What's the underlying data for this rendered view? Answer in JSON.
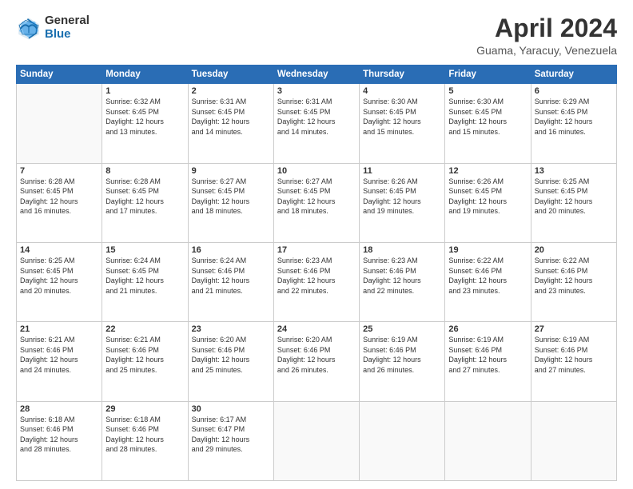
{
  "header": {
    "logo_general": "General",
    "logo_blue": "Blue",
    "month_title": "April 2024",
    "location": "Guama, Yaracuy, Venezuela"
  },
  "days_of_week": [
    "Sunday",
    "Monday",
    "Tuesday",
    "Wednesday",
    "Thursday",
    "Friday",
    "Saturday"
  ],
  "weeks": [
    [
      {
        "day": "",
        "info": ""
      },
      {
        "day": "1",
        "info": "Sunrise: 6:32 AM\nSunset: 6:45 PM\nDaylight: 12 hours\nand 13 minutes."
      },
      {
        "day": "2",
        "info": "Sunrise: 6:31 AM\nSunset: 6:45 PM\nDaylight: 12 hours\nand 14 minutes."
      },
      {
        "day": "3",
        "info": "Sunrise: 6:31 AM\nSunset: 6:45 PM\nDaylight: 12 hours\nand 14 minutes."
      },
      {
        "day": "4",
        "info": "Sunrise: 6:30 AM\nSunset: 6:45 PM\nDaylight: 12 hours\nand 15 minutes."
      },
      {
        "day": "5",
        "info": "Sunrise: 6:30 AM\nSunset: 6:45 PM\nDaylight: 12 hours\nand 15 minutes."
      },
      {
        "day": "6",
        "info": "Sunrise: 6:29 AM\nSunset: 6:45 PM\nDaylight: 12 hours\nand 16 minutes."
      }
    ],
    [
      {
        "day": "7",
        "info": "Sunrise: 6:28 AM\nSunset: 6:45 PM\nDaylight: 12 hours\nand 16 minutes."
      },
      {
        "day": "8",
        "info": "Sunrise: 6:28 AM\nSunset: 6:45 PM\nDaylight: 12 hours\nand 17 minutes."
      },
      {
        "day": "9",
        "info": "Sunrise: 6:27 AM\nSunset: 6:45 PM\nDaylight: 12 hours\nand 18 minutes."
      },
      {
        "day": "10",
        "info": "Sunrise: 6:27 AM\nSunset: 6:45 PM\nDaylight: 12 hours\nand 18 minutes."
      },
      {
        "day": "11",
        "info": "Sunrise: 6:26 AM\nSunset: 6:45 PM\nDaylight: 12 hours\nand 19 minutes."
      },
      {
        "day": "12",
        "info": "Sunrise: 6:26 AM\nSunset: 6:45 PM\nDaylight: 12 hours\nand 19 minutes."
      },
      {
        "day": "13",
        "info": "Sunrise: 6:25 AM\nSunset: 6:45 PM\nDaylight: 12 hours\nand 20 minutes."
      }
    ],
    [
      {
        "day": "14",
        "info": "Sunrise: 6:25 AM\nSunset: 6:45 PM\nDaylight: 12 hours\nand 20 minutes."
      },
      {
        "day": "15",
        "info": "Sunrise: 6:24 AM\nSunset: 6:45 PM\nDaylight: 12 hours\nand 21 minutes."
      },
      {
        "day": "16",
        "info": "Sunrise: 6:24 AM\nSunset: 6:46 PM\nDaylight: 12 hours\nand 21 minutes."
      },
      {
        "day": "17",
        "info": "Sunrise: 6:23 AM\nSunset: 6:46 PM\nDaylight: 12 hours\nand 22 minutes."
      },
      {
        "day": "18",
        "info": "Sunrise: 6:23 AM\nSunset: 6:46 PM\nDaylight: 12 hours\nand 22 minutes."
      },
      {
        "day": "19",
        "info": "Sunrise: 6:22 AM\nSunset: 6:46 PM\nDaylight: 12 hours\nand 23 minutes."
      },
      {
        "day": "20",
        "info": "Sunrise: 6:22 AM\nSunset: 6:46 PM\nDaylight: 12 hours\nand 23 minutes."
      }
    ],
    [
      {
        "day": "21",
        "info": "Sunrise: 6:21 AM\nSunset: 6:46 PM\nDaylight: 12 hours\nand 24 minutes."
      },
      {
        "day": "22",
        "info": "Sunrise: 6:21 AM\nSunset: 6:46 PM\nDaylight: 12 hours\nand 25 minutes."
      },
      {
        "day": "23",
        "info": "Sunrise: 6:20 AM\nSunset: 6:46 PM\nDaylight: 12 hours\nand 25 minutes."
      },
      {
        "day": "24",
        "info": "Sunrise: 6:20 AM\nSunset: 6:46 PM\nDaylight: 12 hours\nand 26 minutes."
      },
      {
        "day": "25",
        "info": "Sunrise: 6:19 AM\nSunset: 6:46 PM\nDaylight: 12 hours\nand 26 minutes."
      },
      {
        "day": "26",
        "info": "Sunrise: 6:19 AM\nSunset: 6:46 PM\nDaylight: 12 hours\nand 27 minutes."
      },
      {
        "day": "27",
        "info": "Sunrise: 6:19 AM\nSunset: 6:46 PM\nDaylight: 12 hours\nand 27 minutes."
      }
    ],
    [
      {
        "day": "28",
        "info": "Sunrise: 6:18 AM\nSunset: 6:46 PM\nDaylight: 12 hours\nand 28 minutes."
      },
      {
        "day": "29",
        "info": "Sunrise: 6:18 AM\nSunset: 6:46 PM\nDaylight: 12 hours\nand 28 minutes."
      },
      {
        "day": "30",
        "info": "Sunrise: 6:17 AM\nSunset: 6:47 PM\nDaylight: 12 hours\nand 29 minutes."
      },
      {
        "day": "",
        "info": ""
      },
      {
        "day": "",
        "info": ""
      },
      {
        "day": "",
        "info": ""
      },
      {
        "day": "",
        "info": ""
      }
    ]
  ]
}
